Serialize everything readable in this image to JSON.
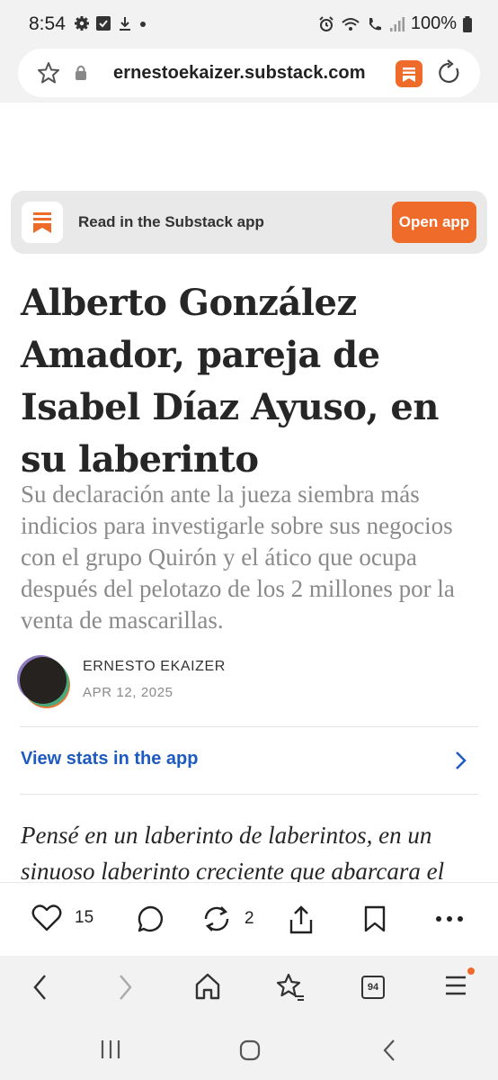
{
  "status_bar": {
    "time": "8:54",
    "battery": "100%",
    "left_icons": [
      "gear-icon",
      "check-box-icon",
      "download-icon",
      "dot-icon"
    ],
    "right_icons": [
      "alarm-icon",
      "wifi-icon",
      "call-icon",
      "signal-icon",
      "battery-icon"
    ]
  },
  "browser": {
    "url": "ernestoekaizer.substack.com",
    "tab_count": "94"
  },
  "app_banner": {
    "text": "Read in the Substack app",
    "button": "Open app"
  },
  "article": {
    "title": "Alberto González Amador, pareja de Isabel Díaz Ayuso, en su laberinto",
    "subtitle": "Su declaración ante la jueza siembra más indicios para investigarle sobre sus negocios con el grupo Quirón y el ático que ocupa después del pelotazo de los 2 millones por la venta de mascarillas.",
    "author": "ERNESTO EKAIZER",
    "date": "APR 12, 2025",
    "stats_link": "View stats in the app",
    "body_start": "Pensé en un laberinto de laberintos, en un sinuoso laberinto creciente que abarcara el"
  },
  "actions": {
    "likes": "15",
    "restacks": "2"
  },
  "colors": {
    "accent": "#ef6b2a",
    "link": "#1d5bc2"
  }
}
